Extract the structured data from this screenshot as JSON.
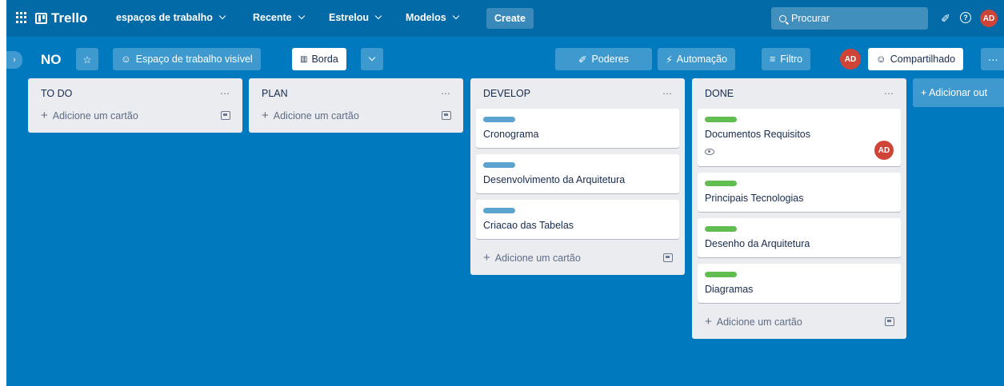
{
  "colors": {
    "board_bg": "#0079bf",
    "nav_bg": "#026aa7",
    "label_blue": "#5ba4cf",
    "label_green": "#61bd4f",
    "avatar": "#d04437"
  },
  "nav": {
    "logo": "Trello",
    "workspaces": "espaços de trabalho",
    "recent": "Recente",
    "starred": "Estrelou",
    "templates": "Modelos",
    "create": "Create",
    "search_placeholder": "Procurar",
    "avatar_initials": "AD"
  },
  "board": {
    "name": "NO",
    "visibility": "Espaço de trabalho visível",
    "view": "Borda",
    "powerups": "Poderes",
    "automation": "Automação",
    "filter": "Filtro",
    "member_initials": "AD",
    "share": "Compartilhado",
    "add_list": "+ Adicionar out"
  },
  "add_card_label": "Adicione um cartão",
  "lists": [
    {
      "title": "TO DO",
      "cards": []
    },
    {
      "title": "PLAN",
      "cards": []
    },
    {
      "title": "DEVELOP",
      "cards": [
        {
          "label": "blue",
          "title": "Cronograma"
        },
        {
          "label": "blue",
          "title": "Desenvolvimento da Arquitetura"
        },
        {
          "label": "blue",
          "title": "Criacao das Tabelas"
        }
      ]
    },
    {
      "title": "DONE",
      "cards": [
        {
          "label": "green",
          "title": "Documentos Requisitos",
          "watching": true,
          "member": "AD"
        },
        {
          "label": "green",
          "title": "Principais Tecnologias"
        },
        {
          "label": "green",
          "title": "Desenho da Arquitetura"
        },
        {
          "label": "green",
          "title": "Diagramas"
        }
      ]
    }
  ]
}
